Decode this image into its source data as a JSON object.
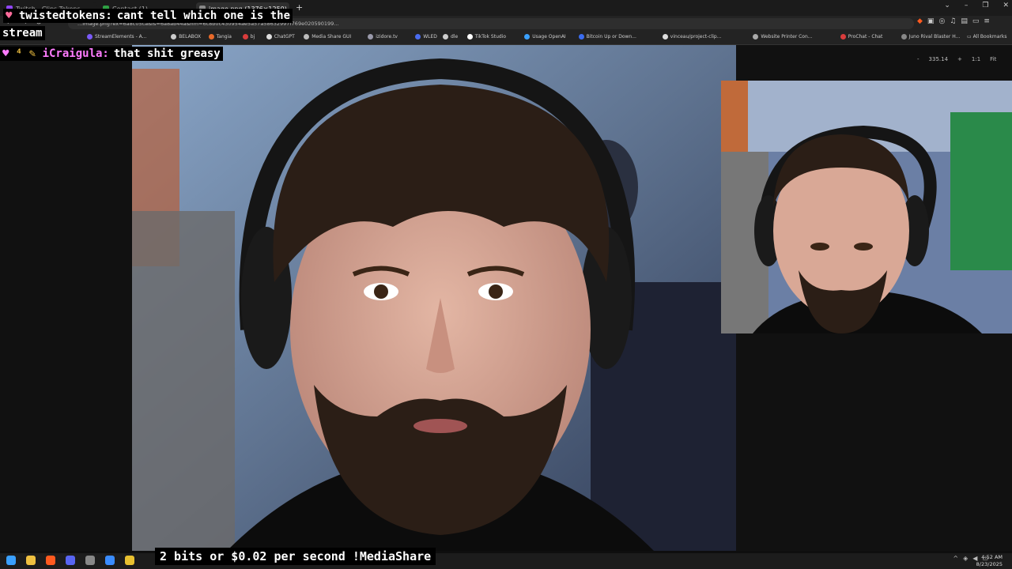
{
  "browser": {
    "tabs": [
      {
        "label": "Twitch - Clips Tokens"
      },
      {
        "label": "Contact (1)"
      },
      {
        "label": "image.png (1376×1250)"
      }
    ],
    "new_tab_label": "+",
    "url": "...image.png?ex=6a8c05ca&is=6a8ab44a&hm=6c8b0c430954ae5a57a58632997f769e020590199...",
    "window_controls": {
      "chevron": "⌄",
      "minimize": "–",
      "restore": "❐",
      "close": "✕"
    },
    "bookmarks": [
      {
        "label": "StreamElements - A...",
        "color": "#7a5af8"
      },
      {
        "label": "BELABOX",
        "color": "#cccccc"
      },
      {
        "label": "Tangia",
        "color": "#e86a2a"
      },
      {
        "label": "bj",
        "color": "#d93c3c"
      },
      {
        "label": "ChatGPT",
        "color": "#dddddd"
      },
      {
        "label": "Media Share GUI",
        "color": "#bbbbbb"
      },
      {
        "label": "izidore.tv",
        "color": "#9999aa"
      },
      {
        "label": "WLED",
        "color": "#4a6cf0"
      },
      {
        "label": "dle",
        "color": "#cccccc"
      },
      {
        "label": "TikTok Studio",
        "color": "#ffffff"
      },
      {
        "label": "Usage OpenAI",
        "color": "#3aa0ff"
      },
      {
        "label": "Bitcoin Up or Down...",
        "color": "#3a6cf0"
      },
      {
        "label": "vinceau/project-clip...",
        "color": "#dddddd"
      },
      {
        "label": "Website Printer Con...",
        "color": "#aaaaaa"
      },
      {
        "label": "ProChat - Chat",
        "color": "#d93c3c"
      },
      {
        "label": "Juno Rival Blaster H...",
        "color": "#888888"
      }
    ],
    "all_bookmarks": "All Bookmarks"
  },
  "viewer": {
    "zoom_out": "-",
    "zoom_value": "335.14",
    "zoom_in": "+",
    "one_to_one": "1:1",
    "fit": "Fit"
  },
  "chat": [
    {
      "user": "twistedtokens:",
      "message": "cant tell which one is the",
      "continuation": "stream",
      "user_color": "#ffffff"
    },
    {
      "user": "iCraigula:",
      "message": "that shit greasy",
      "user_color": "#ff7bff"
    }
  ],
  "overlay": {
    "mediashare": "2 bits or $0.02 per second !MediaShare"
  },
  "taskbar": {
    "time": "4:52 AM",
    "date": "8/23/2025",
    "apps": [
      {
        "name": "windows-icon",
        "color": "#3aa0ff"
      },
      {
        "name": "file-explorer-icon",
        "color": "#f0c040"
      },
      {
        "name": "brave-icon",
        "color": "#ff5a1f"
      },
      {
        "name": "discord-icon",
        "color": "#5865f2"
      },
      {
        "name": "obs-icon",
        "color": "#888888"
      },
      {
        "name": "app-icon",
        "color": "#3a8cff"
      },
      {
        "name": "chrome-icon",
        "color": "#e8c030"
      }
    ]
  },
  "colors": {
    "chat_bg": "#000000",
    "viewer_bg": "#111111",
    "browser_bg": "#232323"
  }
}
